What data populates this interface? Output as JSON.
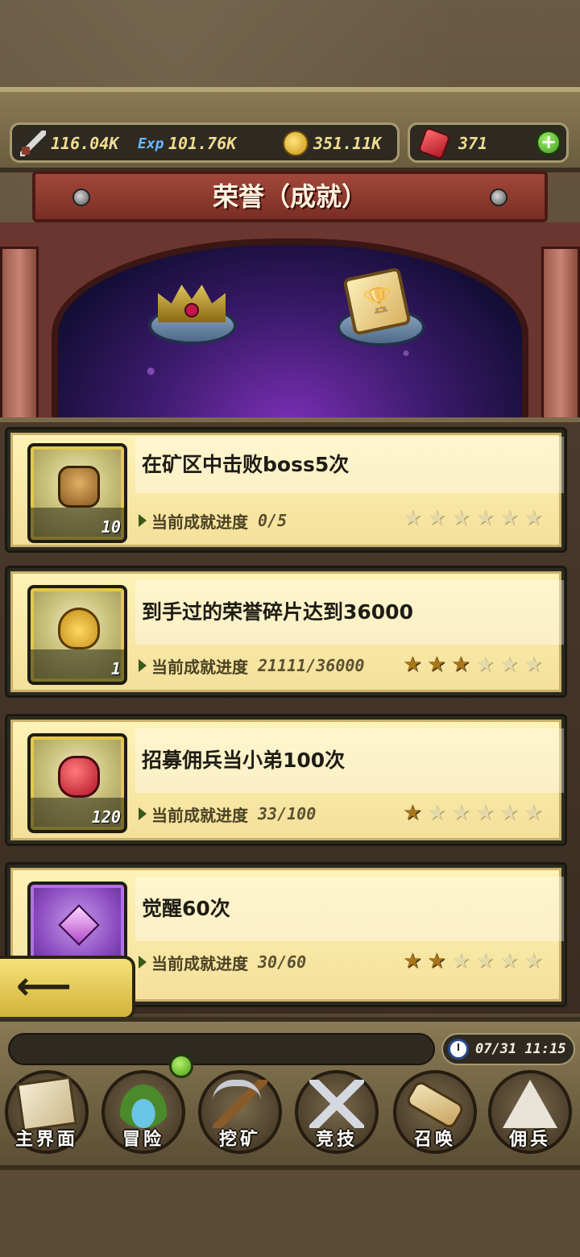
{
  "currencies": {
    "attack": {
      "icon": "sword-icon",
      "value": "116.04K"
    },
    "exp": {
      "icon": "exp-icon",
      "label": "Exp",
      "value": "101.76K"
    },
    "gold": {
      "icon": "gold-coin-icon",
      "value": "351.11K"
    },
    "gems": {
      "icon": "ruby-gem-icon",
      "value": "371"
    }
  },
  "header": {
    "title": "荣誉（成就）"
  },
  "achievements": [
    {
      "title": "在矿区中击败boss5次",
      "item_count": "10",
      "progress_label": "当前成就进度",
      "progress": "0/5",
      "stars_filled": 0,
      "stars_total": 6,
      "icon": "golem-icon"
    },
    {
      "title": "到手过的荣誉碎片达到36000",
      "item_count": "1",
      "progress_label": "当前成就进度",
      "progress": "21111/36000",
      "stars_filled": 3,
      "stars_total": 6,
      "icon": "gold-bag-icon"
    },
    {
      "title": "招募佣兵当小弟100次",
      "item_count": "120",
      "progress_label": "当前成就进度",
      "progress": "33/100",
      "stars_filled": 1,
      "stars_total": 6,
      "icon": "ruby-icon"
    },
    {
      "title": "觉醒60次",
      "item_count": "",
      "progress_label": "当前成就进度",
      "progress": "30/60",
      "stars_filled": 2,
      "stars_total": 6,
      "icon": "purple-crystal-icon"
    }
  ],
  "back_button": {
    "icon": "back-arrow-icon",
    "label": "⟵"
  },
  "clock": {
    "icon": "clock-icon",
    "text": "07/31 11:15"
  },
  "nav": [
    {
      "id": "home",
      "label": "主界面",
      "icon": "map-scroll-icon"
    },
    {
      "id": "adventure",
      "label": "冒险",
      "icon": "island-icon"
    },
    {
      "id": "mining",
      "label": "挖矿",
      "icon": "pickaxe-icon"
    },
    {
      "id": "arena",
      "label": "竞技",
      "icon": "crossed-swords-icon"
    },
    {
      "id": "summon",
      "label": "召唤",
      "icon": "summon-scroll-icon"
    },
    {
      "id": "mercenary",
      "label": "佣兵",
      "icon": "tent-icon"
    }
  ],
  "colors": {
    "accent": "#f1dd91",
    "banner": "#a2473a",
    "card_bg": "#f4e09a",
    "star_on": "#a8761a",
    "star_off": "#e4d9a8"
  }
}
